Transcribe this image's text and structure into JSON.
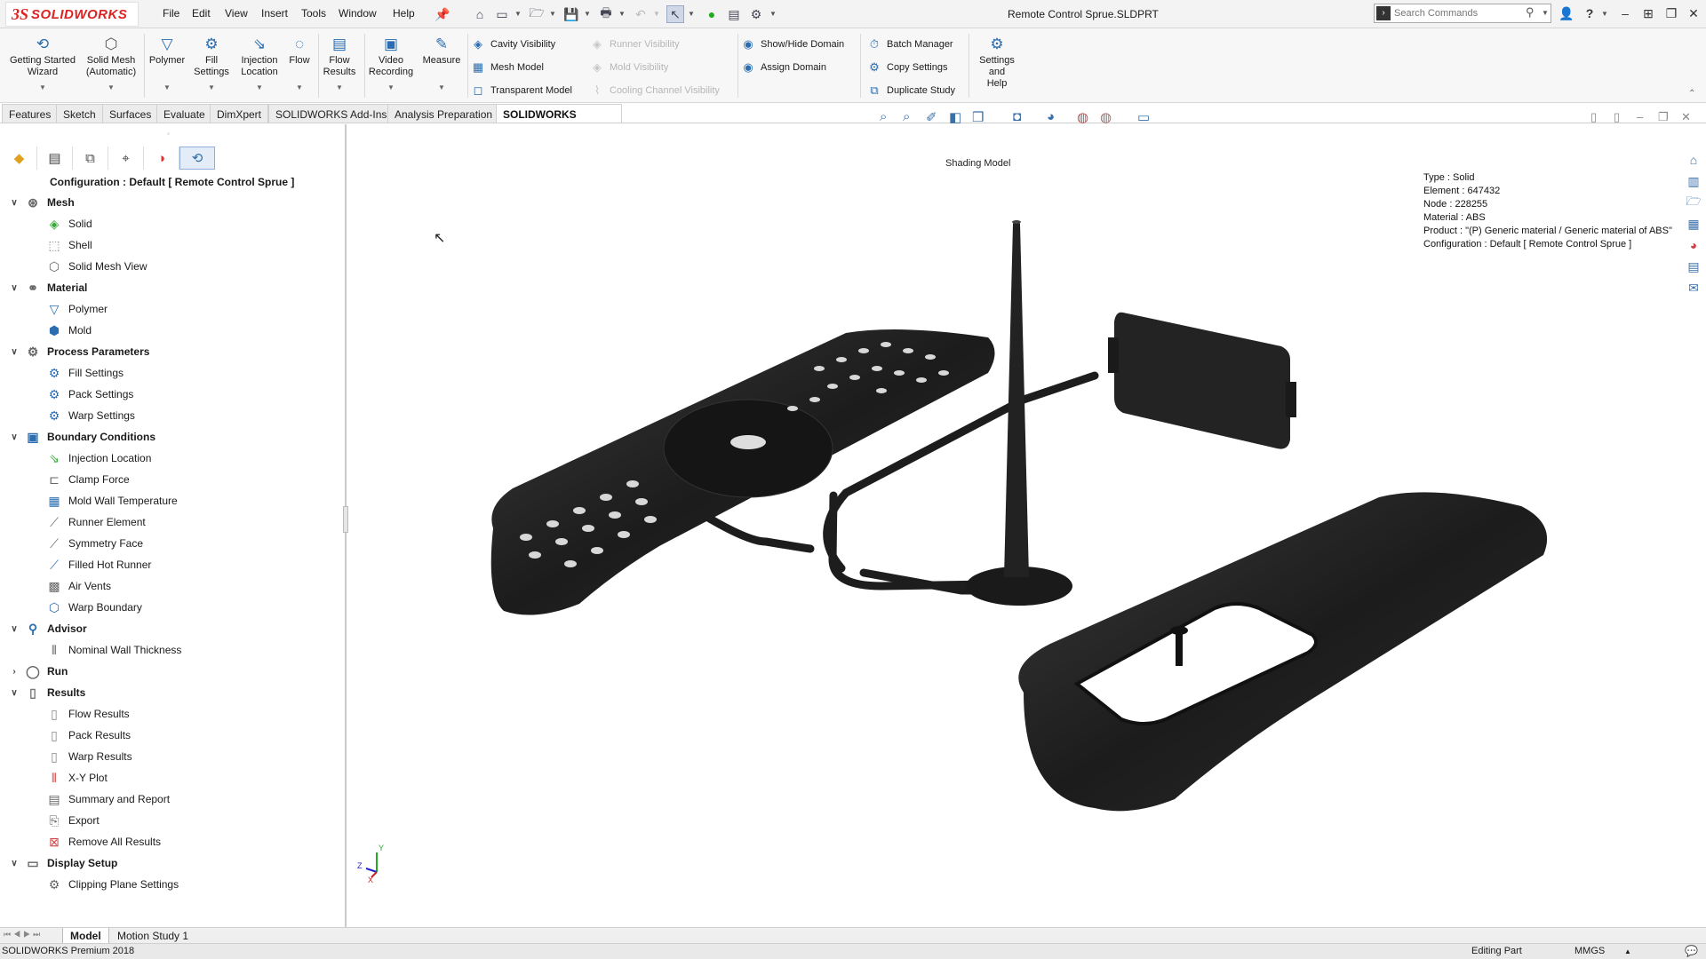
{
  "titlebar": {
    "logo_ds": "3S",
    "logo_text": "SOLIDWORKS",
    "menus": [
      "File",
      "Edit",
      "View",
      "Insert",
      "Tools",
      "Window",
      "Help"
    ],
    "document_title": "Remote Control Sprue.SLDPRT",
    "search_placeholder": "Search Commands"
  },
  "ribbon": {
    "big_buttons": [
      {
        "label1": "Getting Started",
        "label2": "Wizard",
        "icon": "wizard-icon"
      },
      {
        "label1": "Solid Mesh",
        "label2": "(Automatic)",
        "icon": "solid-mesh-icon"
      },
      {
        "label1": "Polymer",
        "label2": "",
        "icon": "polymer-icon"
      },
      {
        "label1": "Fill",
        "label2": "Settings",
        "icon": "fill-settings-icon"
      },
      {
        "label1": "Injection",
        "label2": "Location",
        "icon": "injection-location-icon"
      },
      {
        "label1": "Flow",
        "label2": "",
        "icon": "flow-icon"
      },
      {
        "label1": "Flow",
        "label2": "Results",
        "icon": "flow-results-icon"
      },
      {
        "label1": "Video",
        "label2": "Recording",
        "icon": "video-recording-icon"
      },
      {
        "label1": "Measure",
        "label2": "",
        "icon": "measure-icon"
      }
    ],
    "col1": [
      "Cavity Visibility",
      "Mesh Model",
      "Transparent Model"
    ],
    "col2": [
      "Runner Visibility",
      "Mold Visibility",
      "Cooling Channel Visibility"
    ],
    "col3": [
      "Show/Hide Domain",
      "Assign Domain"
    ],
    "col4": [
      "Batch Manager",
      "Copy Settings",
      "Duplicate Study"
    ],
    "settings_help": {
      "line1": "Settings",
      "line2": "and",
      "line3": "Help"
    }
  },
  "tabs": [
    "Features",
    "Sketch",
    "Surfaces",
    "Evaluate",
    "DimXpert",
    "SOLIDWORKS Add-Ins",
    "Analysis Preparation",
    "SOLIDWORKS Plastics"
  ],
  "active_tab": "SOLIDWORKS Plastics",
  "tree": {
    "config": "Configuration : Default [ Remote Control Sprue ]",
    "mesh": {
      "label": "Mesh",
      "items": [
        "Solid",
        "Shell",
        "Solid Mesh View"
      ]
    },
    "material": {
      "label": "Material",
      "items": [
        "Polymer",
        "Mold"
      ]
    },
    "process": {
      "label": "Process Parameters",
      "items": [
        "Fill Settings",
        "Pack Settings",
        "Warp Settings"
      ]
    },
    "boundary": {
      "label": "Boundary Conditions",
      "items": [
        "Injection Location",
        "Clamp Force",
        "Mold Wall Temperature",
        "Runner Element",
        "Symmetry Face",
        "Filled Hot Runner",
        "Air Vents",
        "Warp Boundary"
      ]
    },
    "advisor": {
      "label": "Advisor",
      "items": [
        "Nominal Wall Thickness"
      ]
    },
    "run": {
      "label": "Run"
    },
    "results": {
      "label": "Results",
      "items": [
        "Flow Results",
        "Pack Results",
        "Warp Results",
        "X-Y Plot",
        "Summary and Report",
        "Export",
        "Remove All Results"
      ]
    },
    "display": {
      "label": "Display Setup",
      "items": [
        "Clipping Plane Settings"
      ]
    }
  },
  "viewport": {
    "shading_label": "Shading Model",
    "info": [
      "Type : Solid",
      "Element : 647432",
      "Node : 228255",
      "Material : ABS",
      "Product :   \"(P)  Generic material / Generic material of ABS\"",
      "Configuration : Default [ Remote Control Sprue ]"
    ],
    "triad": {
      "y": "Y",
      "z": "Z",
      "x": "X"
    }
  },
  "bottom_tabs": [
    "Model",
    "Motion Study 1"
  ],
  "status": {
    "product": "SOLIDWORKS Premium 2018",
    "mode": "Editing Part",
    "units": "MMGS"
  }
}
